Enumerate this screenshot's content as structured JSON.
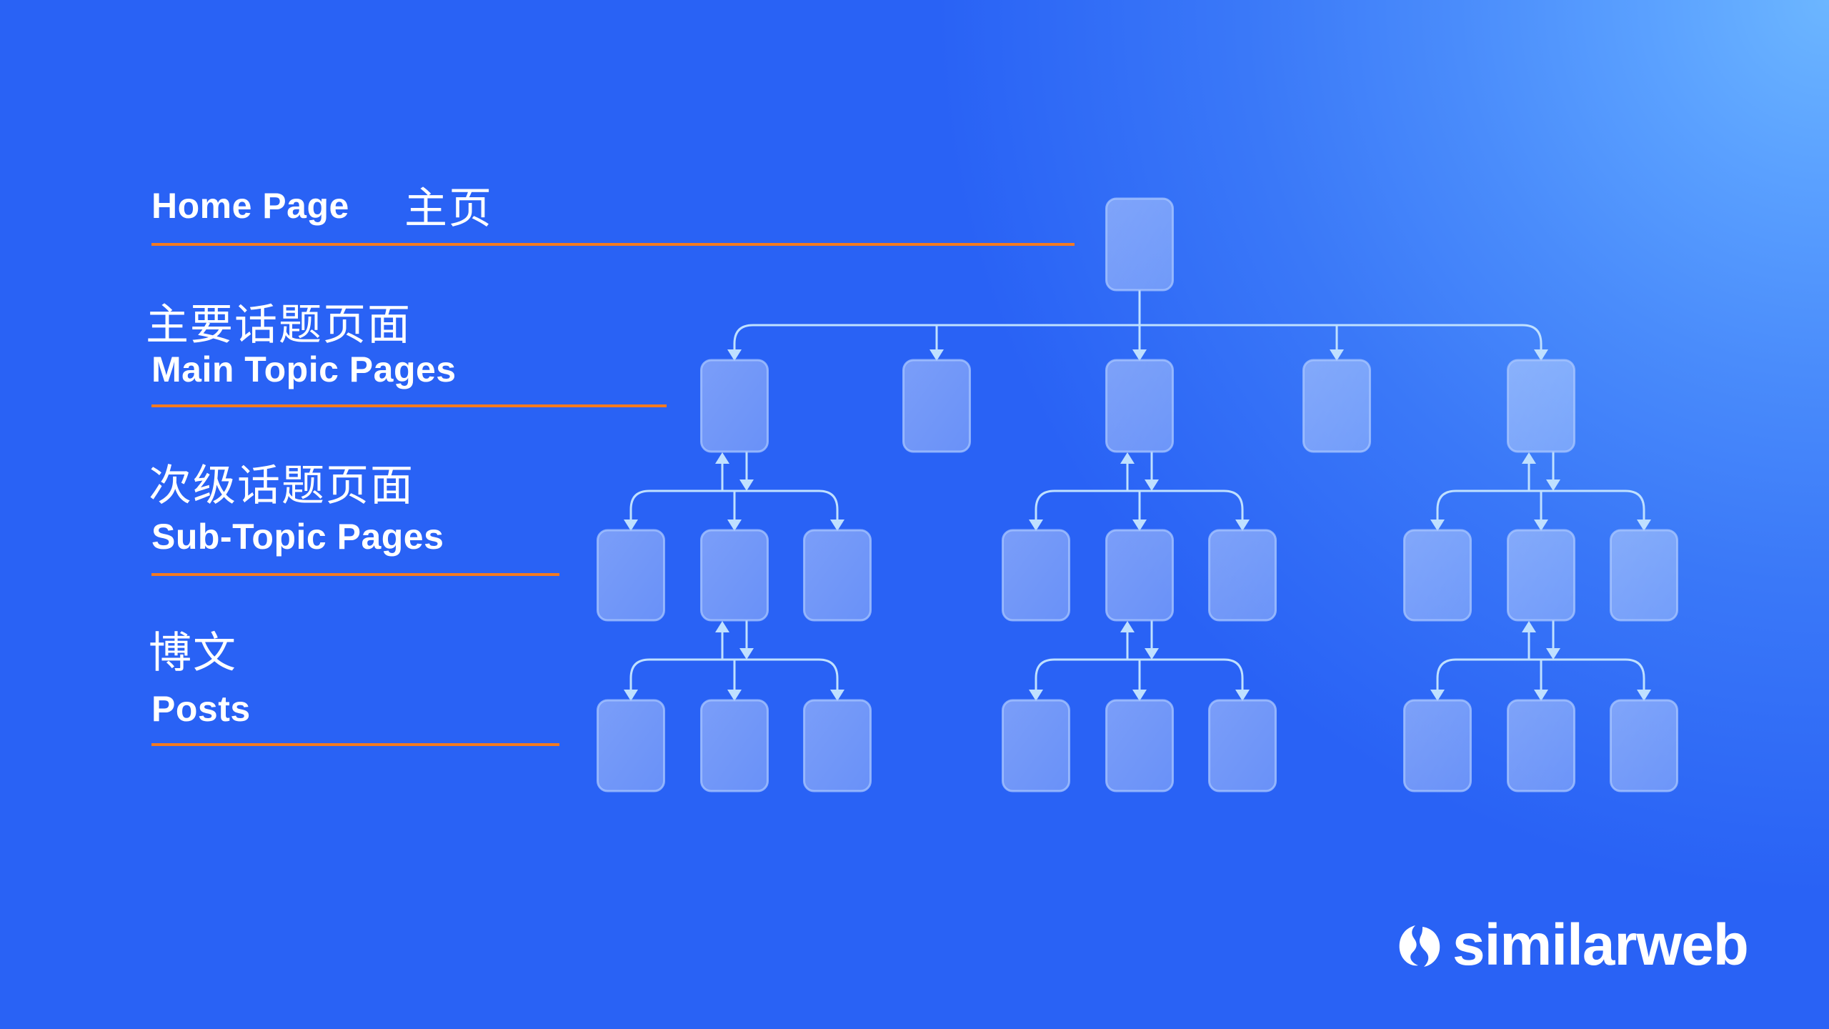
{
  "levels": [
    {
      "en": "Home Page",
      "zh": "主页"
    },
    {
      "en": "Main Topic Pages",
      "zh": "主要话题页面"
    },
    {
      "en": "Sub-Topic Pages",
      "zh": "次级话题页面"
    },
    {
      "en": "Posts",
      "zh": "博文"
    }
  ],
  "tree": {
    "root_count": 1,
    "main_topic_count": 5,
    "expanded_main_topics": [
      1,
      3,
      5
    ],
    "subtopics_per_main": 3,
    "posts_per_subtopic_expanded": 3,
    "expanded_subtopic": "middle"
  },
  "colors": {
    "background": "#2962f5",
    "accent_rule": "#f47a20",
    "node_fill": "#7aa3fa",
    "node_stroke": "#a9c7ff",
    "connector": "#bfe0ff",
    "text": "#ffffff"
  },
  "brand": {
    "name": "similarweb",
    "icon": "similarweb-logo-icon"
  }
}
